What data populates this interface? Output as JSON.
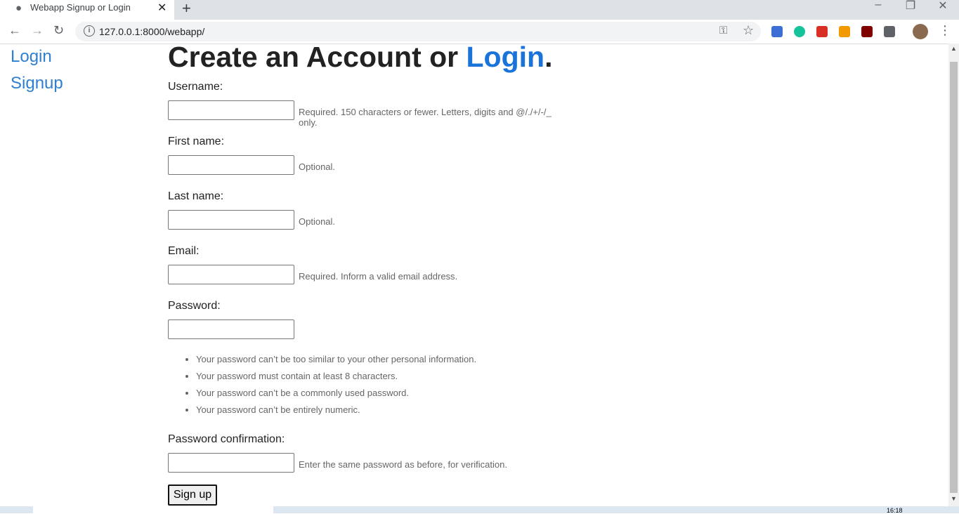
{
  "browser": {
    "tab_title": "Webapp Signup or Login",
    "url": "127.0.0.1:8000/webapp/",
    "new_tab_label": "+",
    "close_tab_label": "✕"
  },
  "sidebar": {
    "items": [
      {
        "label": "Login"
      },
      {
        "label": "Signup"
      }
    ]
  },
  "main": {
    "heading_prefix": "Create an Account or ",
    "heading_link": "Login",
    "heading_suffix": ".",
    "fields": [
      {
        "label": "Username:",
        "value": "",
        "help": "Required. 150 characters or fewer. Letters, digits and @/./+/-/_ only."
      },
      {
        "label": "First name:",
        "value": "",
        "help": "Optional."
      },
      {
        "label": "Last name:",
        "value": "",
        "help": "Optional."
      },
      {
        "label": "Email:",
        "value": "",
        "help": "Required. Inform a valid email address."
      },
      {
        "label": "Password:",
        "value": "",
        "help": ""
      },
      {
        "label": "Password confirmation:",
        "value": "",
        "help": "Enter the same password as before, for verification."
      }
    ],
    "password_rules": [
      "Your password can’t be too similar to your other personal information.",
      "Your password must contain at least 8 characters.",
      "Your password can’t be a commonly used password.",
      "Your password can’t be entirely numeric."
    ],
    "submit_label": "Sign up"
  },
  "taskbar": {
    "clock": "16:18"
  },
  "colors": {
    "link": "#2f80d1",
    "heading_link": "#1a73d9",
    "help_text": "#666666"
  }
}
